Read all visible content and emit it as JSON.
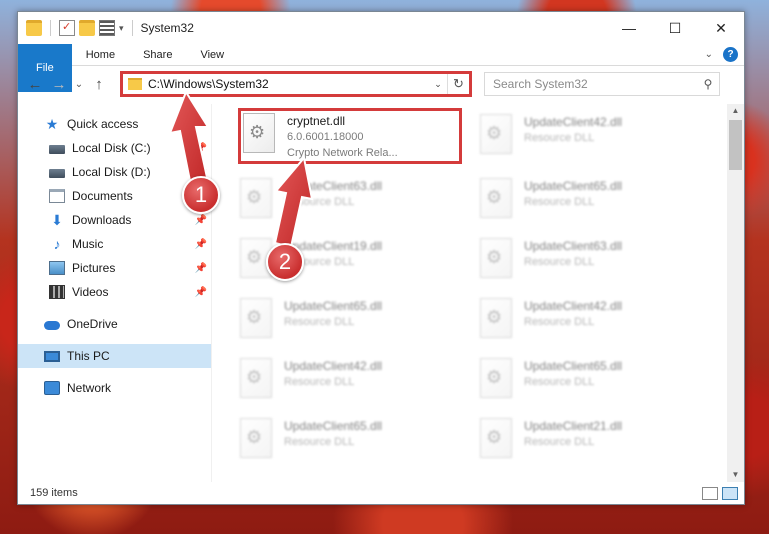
{
  "window": {
    "title": "System32",
    "controls": {
      "minimize": "—",
      "maximize": "☐",
      "close": "✕"
    }
  },
  "ribbon": {
    "tabs": [
      "File",
      "Home",
      "Share",
      "View"
    ],
    "help": "?"
  },
  "nav": {
    "back": "←",
    "forward": "→",
    "recent": "⌄",
    "up": "↑",
    "address": "C:\\Windows\\System32",
    "search_placeholder": "Search System32"
  },
  "sidebar": {
    "items": [
      {
        "label": "Quick access",
        "icon": "star-icon"
      },
      {
        "label": "Local Disk (C:)",
        "icon": "disk-icon",
        "pinned": true
      },
      {
        "label": "Local Disk (D:)",
        "icon": "disk-icon",
        "pinned": true
      },
      {
        "label": "Documents",
        "icon": "documents-icon",
        "pinned": true
      },
      {
        "label": "Downloads",
        "icon": "download-icon",
        "pinned": true
      },
      {
        "label": "Music",
        "icon": "music-icon",
        "pinned": true
      },
      {
        "label": "Pictures",
        "icon": "pictures-icon",
        "pinned": true
      },
      {
        "label": "Videos",
        "icon": "videos-icon",
        "pinned": true
      },
      {
        "label": "OneDrive",
        "icon": "cloud-icon"
      },
      {
        "label": "This PC",
        "icon": "pc-icon",
        "selected": true
      },
      {
        "label": "Network",
        "icon": "network-icon"
      }
    ]
  },
  "files": [
    {
      "name": "cryptnet.dll",
      "version": "6.0.6001.18000",
      "type": "Crypto Network Rela..."
    },
    {
      "name": "UpdateClient42.dll",
      "type": "Resource DLL"
    },
    {
      "name": "UpdateClient63.dll",
      "type": "Resource DLL"
    },
    {
      "name": "UpdateClient65.dll",
      "type": "Resource DLL"
    },
    {
      "name": "UpdateClient19.dll",
      "type": "Resource DLL"
    },
    {
      "name": "UpdateClient63.dll",
      "type": "Resource DLL"
    },
    {
      "name": "UpdateClient65.dll",
      "type": "Resource DLL"
    },
    {
      "name": "UpdateClient42.dll",
      "type": "Resource DLL"
    },
    {
      "name": "UpdateClient42.dll",
      "type": "Resource DLL"
    },
    {
      "name": "UpdateClient65.dll",
      "type": "Resource DLL"
    },
    {
      "name": "UpdateClient65.dll",
      "type": "Resource DLL"
    },
    {
      "name": "UpdateClient21.dll",
      "type": "Resource DLL"
    }
  ],
  "status": {
    "item_count": "159 items"
  },
  "annotations": {
    "step1": "1",
    "step2": "2",
    "color": "#d43b3b"
  }
}
